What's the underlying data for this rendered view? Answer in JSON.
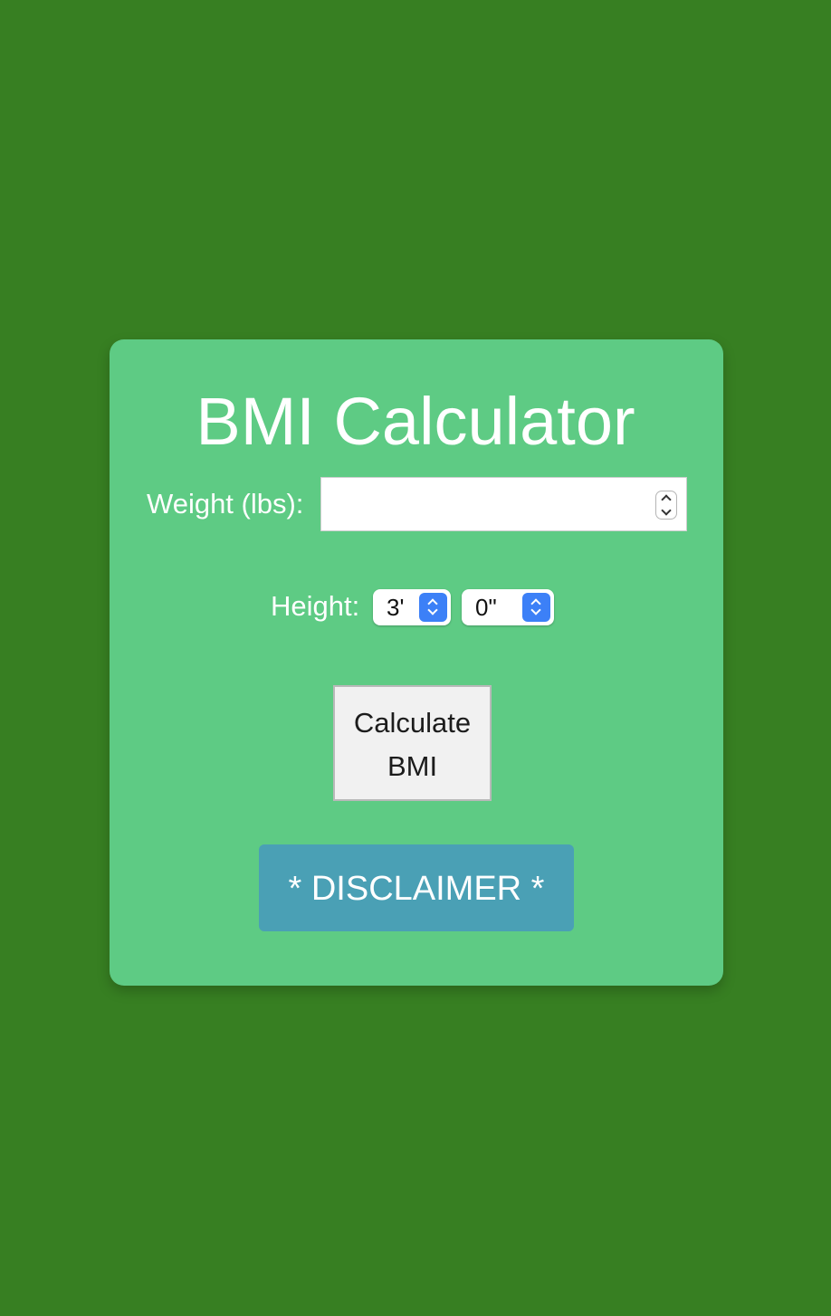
{
  "colors": {
    "page_background": "#377f22",
    "card_background": "#5ecb84",
    "accent_select": "#3c80f7",
    "disclaimer_button": "#4aa0b5"
  },
  "app": {
    "title": "BMI Calculator"
  },
  "form": {
    "weight_label": "Weight (lbs):",
    "weight_value": "",
    "height_label": "Height:",
    "height_feet_selected": "3'",
    "height_inches_selected": "0\""
  },
  "buttons": {
    "calculate_label": "Calculate BMI",
    "disclaimer_label": "* DISCLAIMER *"
  },
  "icons": {
    "weight_spinner": "stepper-icon",
    "select_arrows": "chevron-updown-icon"
  }
}
